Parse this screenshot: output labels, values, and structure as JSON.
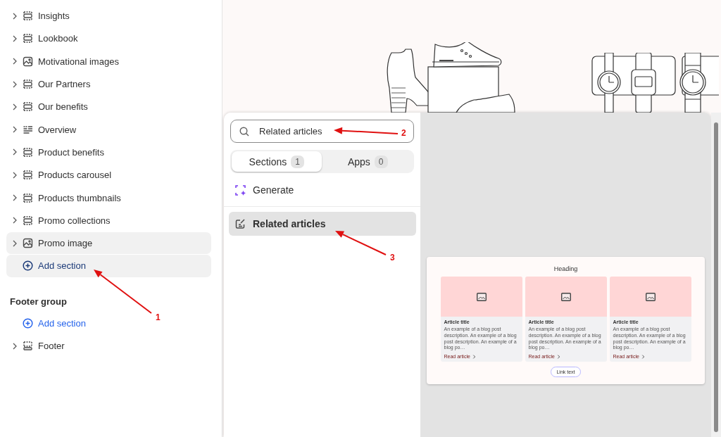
{
  "sidebar": {
    "items": [
      {
        "label": "Insights",
        "kind": "section",
        "highlighted": false
      },
      {
        "label": "Lookbook",
        "kind": "section",
        "highlighted": false
      },
      {
        "label": "Motivational images",
        "kind": "image",
        "highlighted": false
      },
      {
        "label": "Our Partners",
        "kind": "section",
        "highlighted": false
      },
      {
        "label": "Our benefits",
        "kind": "section",
        "highlighted": false
      },
      {
        "label": "Overview",
        "kind": "text",
        "highlighted": false
      },
      {
        "label": "Product benefits",
        "kind": "section",
        "highlighted": false
      },
      {
        "label": "Products carousel",
        "kind": "section",
        "highlighted": false
      },
      {
        "label": "Products thumbnails",
        "kind": "section",
        "highlighted": false
      },
      {
        "label": "Promo collections",
        "kind": "section",
        "highlighted": false
      },
      {
        "label": "Promo image",
        "kind": "image",
        "highlighted": true
      }
    ],
    "add_section": {
      "label": "Add section",
      "highlighted": true
    },
    "footer_group": {
      "title": "Footer group",
      "add_section": {
        "label": "Add section",
        "highlighted": false
      },
      "items": [
        {
          "label": "Footer",
          "kind": "footer",
          "highlighted": false
        }
      ]
    }
  },
  "picker": {
    "search": {
      "value": "Related articles"
    },
    "tabs": [
      {
        "label": "Sections",
        "count": "1",
        "selected": true
      },
      {
        "label": "Apps",
        "count": "0",
        "selected": false
      }
    ],
    "generate": "Generate",
    "results": [
      {
        "label": "Related articles",
        "selected": true
      }
    ]
  },
  "preview": {
    "heading": "Heading",
    "cards": [
      {
        "title": "Article title",
        "description": "An example of a blog post description. An example of a blog post description. An example of a blog po…",
        "link": "Read article"
      },
      {
        "title": "Article title",
        "description": "An example of a blog post description. An example of a blog post description. An example of a blog po…",
        "link": "Read article"
      },
      {
        "title": "Article title",
        "description": "An example of a blog post description. An example of a blog post description. An example of a blog po…",
        "link": "Read article"
      }
    ],
    "button": "Link text"
  },
  "annotations": [
    {
      "number": "1"
    },
    {
      "number": "2"
    },
    {
      "number": "3"
    }
  ]
}
